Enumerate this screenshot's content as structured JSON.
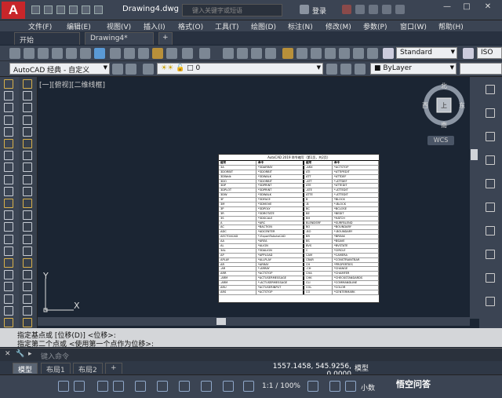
{
  "title_bar": {
    "logo": "A",
    "document_title": "Drawing4.dwg",
    "search_placeholder": "键入关键字或短语",
    "login_label": "登录",
    "window_min": "—",
    "window_max": "□",
    "window_close": "✕"
  },
  "menu": [
    "文件(F)",
    "编辑(E)",
    "视图(V)",
    "插入(I)",
    "格式(O)",
    "工具(T)",
    "绘图(D)",
    "标注(N)",
    "修改(M)",
    "参数(P)",
    "窗口(W)",
    "帮助(H)"
  ],
  "file_tabs": [
    "开始",
    "Drawing4*"
  ],
  "file_tab_add": "+",
  "toolbar": {
    "text_style": "Standard",
    "iso_label": "ISO",
    "workspace": "AutoCAD 经典 - 自定义",
    "layer": "0",
    "linetype": "ByLayer"
  },
  "viewport_label": "[一][俯视][二维线框]",
  "viewcube": {
    "north": "北",
    "south": "南",
    "east": "东",
    "west": "西",
    "top": "上",
    "wcs": "WCS"
  },
  "ucs": {
    "x_label": "X",
    "y_label": "Y"
  },
  "table": {
    "title": "AutoCAD 2019 命令缩写（第1页，共2页）",
    "headers": [
      "缩写",
      "命令",
      "缩写",
      "命令"
    ],
    "rows": [
      [
        "3A",
        "*3DARRAY",
        "-ARX",
        "*ACTSTOP"
      ],
      [
        "3DORBIT",
        "*3DORBIT",
        "ATI",
        "*ATTIPEDIT"
      ],
      [
        "3DWalk",
        "*3DWALK",
        "ATT",
        "*ATTDEF"
      ],
      [
        "3DO",
        "*3DORBIT",
        "-ATT",
        "*-ATTDEF"
      ],
      [
        "3DP",
        "*3DPRINT",
        "ATE",
        "*ATTEDIT"
      ],
      [
        "3DPLOT",
        "*3DPRINT",
        "-ATE",
        "*-ATTEDIT"
      ],
      [
        "3DW",
        "*3DWALK",
        "ATTE",
        "*-ATTEDIT"
      ],
      [
        "3F",
        "*3DFACE",
        "B",
        "*BLOCK"
      ],
      [
        "3M",
        "*3DMOVE",
        "-B",
        "*-BLOCK"
      ],
      [
        "3P",
        "*3DPOLY",
        "BC",
        "*BCLOSE"
      ],
      [
        "3R",
        "*3DROTATE",
        "BE",
        "*BEDIT"
      ],
      [
        "3S",
        "*3DSCALE",
        "BH",
        "*HATCH"
      ],
      [
        "A",
        "*ARC",
        "BLENDSRF",
        "*SURFBLEND"
      ],
      [
        "AC",
        "*BACTION",
        "BO",
        "*BOUNDARY"
      ],
      [
        "ADC",
        "*ADCENTER",
        "-BO",
        "*-BOUNDARY"
      ],
      [
        "AECTOACAD",
        "*-ExportToAutoCAD",
        "BR",
        "*BREAK"
      ],
      [
        "AA",
        "*AREA",
        "BS",
        "*BSAVE"
      ],
      [
        "AL",
        "*ALIGN",
        "BVS",
        "*BVSTATE"
      ],
      [
        "3AL",
        "*3DALIGN",
        "C",
        "*CIRCLE"
      ],
      [
        "AP",
        "*APPLOAD",
        "CAM",
        "*CAMERA"
      ],
      [
        "APLAY",
        "*ALLPLAY",
        "CBAR",
        "*CONSTRAINTBAR"
      ],
      [
        "AR",
        "*ARRAY",
        "CH",
        "*PROPERTIES"
      ],
      [
        "-AR",
        "*-ARRAY",
        "-CH",
        "*CHANGE"
      ],
      [
        "ARR",
        "*ACTSTOP",
        "CHA",
        "*CHAMFER"
      ],
      [
        "-ARM",
        "*ACTUSERMESSAGE",
        "CHK",
        "*CHECKSTANDARDS"
      ],
      [
        "-ARM",
        "*-ACTUSERMESSAGE",
        "CLI",
        "*COMMANDLINE"
      ],
      [
        "ARU",
        "*ACTUSERINPUT",
        "COL",
        "*COLOR"
      ],
      [
        "ARS",
        "*ACTSTOP",
        "CO",
        "*CENTERMARK"
      ]
    ]
  },
  "command_history": [
    "指定基点或 [位移(D)] <位移>:",
    "指定第二个点或 <使用第一个点作为位移>:"
  ],
  "command_placeholder": "键入命令",
  "layout_tabs": [
    "模型",
    "布局1",
    "布局2"
  ],
  "layout_add": "+",
  "coordinates": "1557.1458, 545.9256, 0.0000",
  "model_label": "模型",
  "scale_label": "1:1 / 100%",
  "units_label": "小数",
  "watermark": "悟空问答",
  "colors": {
    "accent_red": "#c8262a",
    "canvas": "#1b2533",
    "chrome": "#3b4453"
  }
}
